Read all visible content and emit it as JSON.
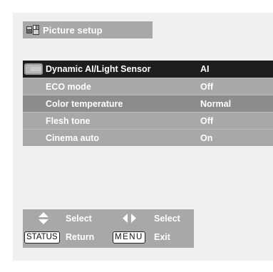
{
  "header": {
    "title": "Picture setup",
    "icon": "picture-setup-icon"
  },
  "menu": {
    "items": [
      {
        "label": "Dynamic AI/Light Sensor",
        "value": "AI",
        "selected": true
      },
      {
        "label": "ECO mode",
        "value": "Off"
      },
      {
        "label": "Color temperature",
        "value": "Normal"
      },
      {
        "label": "Flesh tone",
        "value": "Off"
      },
      {
        "label": "Cinema auto",
        "value": "On"
      }
    ]
  },
  "footer": {
    "updown_select": "Select",
    "leftright_select": "Select",
    "status_key": "STATUS",
    "return_label": "Return",
    "menu_key": "MENU",
    "exit_label": "Exit"
  },
  "colors": {
    "panel": "#a8a8a8",
    "selected_row": "#1e1e1e",
    "alt_row": "#8c8c8c",
    "text": "#ffffff"
  }
}
